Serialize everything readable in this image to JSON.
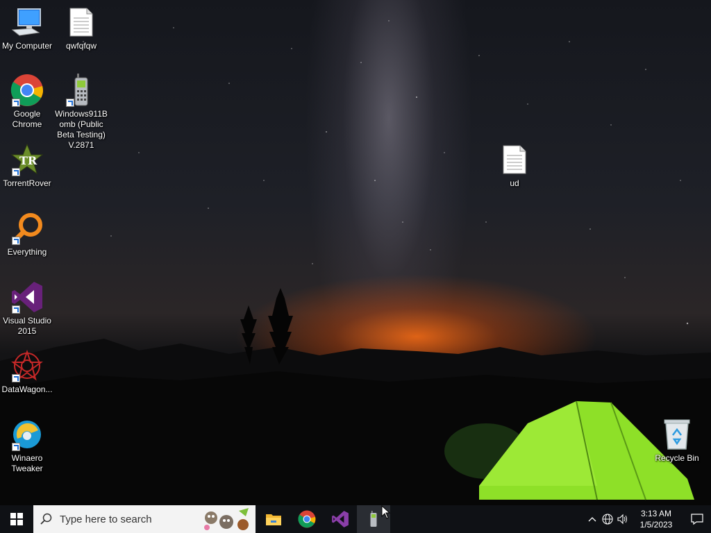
{
  "desktop": {
    "icons": [
      {
        "label": "My Computer",
        "icon": "computer-icon"
      },
      {
        "label": "qwfqfqw",
        "icon": "text-file-icon"
      },
      {
        "label": "Google Chrome",
        "icon": "chrome-icon"
      },
      {
        "label": "Windows911Bomb (Public Beta Testing) V.2871",
        "icon": "phone-icon"
      },
      {
        "label": "TorrentRover",
        "icon": "torrentrover-icon"
      },
      {
        "label": "Everything",
        "icon": "search-magnifier-icon"
      },
      {
        "label": "Visual Studio 2015",
        "icon": "visual-studio-icon"
      },
      {
        "label": "DataWagon...",
        "icon": "datawagon-icon"
      },
      {
        "label": "Winaero Tweaker",
        "icon": "winaero-icon"
      },
      {
        "label": "ud",
        "icon": "text-file-icon"
      },
      {
        "label": "Recycle Bin",
        "icon": "recycle-bin-icon"
      }
    ]
  },
  "taskbar": {
    "search_placeholder": "Type here to search",
    "pinned": [
      "file-explorer-icon",
      "chrome-icon",
      "visual-studio-icon",
      "phone-icon"
    ],
    "clock": {
      "time": "3:13 AM",
      "date": "1/5/2023"
    }
  },
  "colors": {
    "taskbar_bg": "#0f1115",
    "search_bg": "#f3f3f3",
    "visual_studio_purple": "#68217a",
    "tent_green": "#8ee028"
  }
}
